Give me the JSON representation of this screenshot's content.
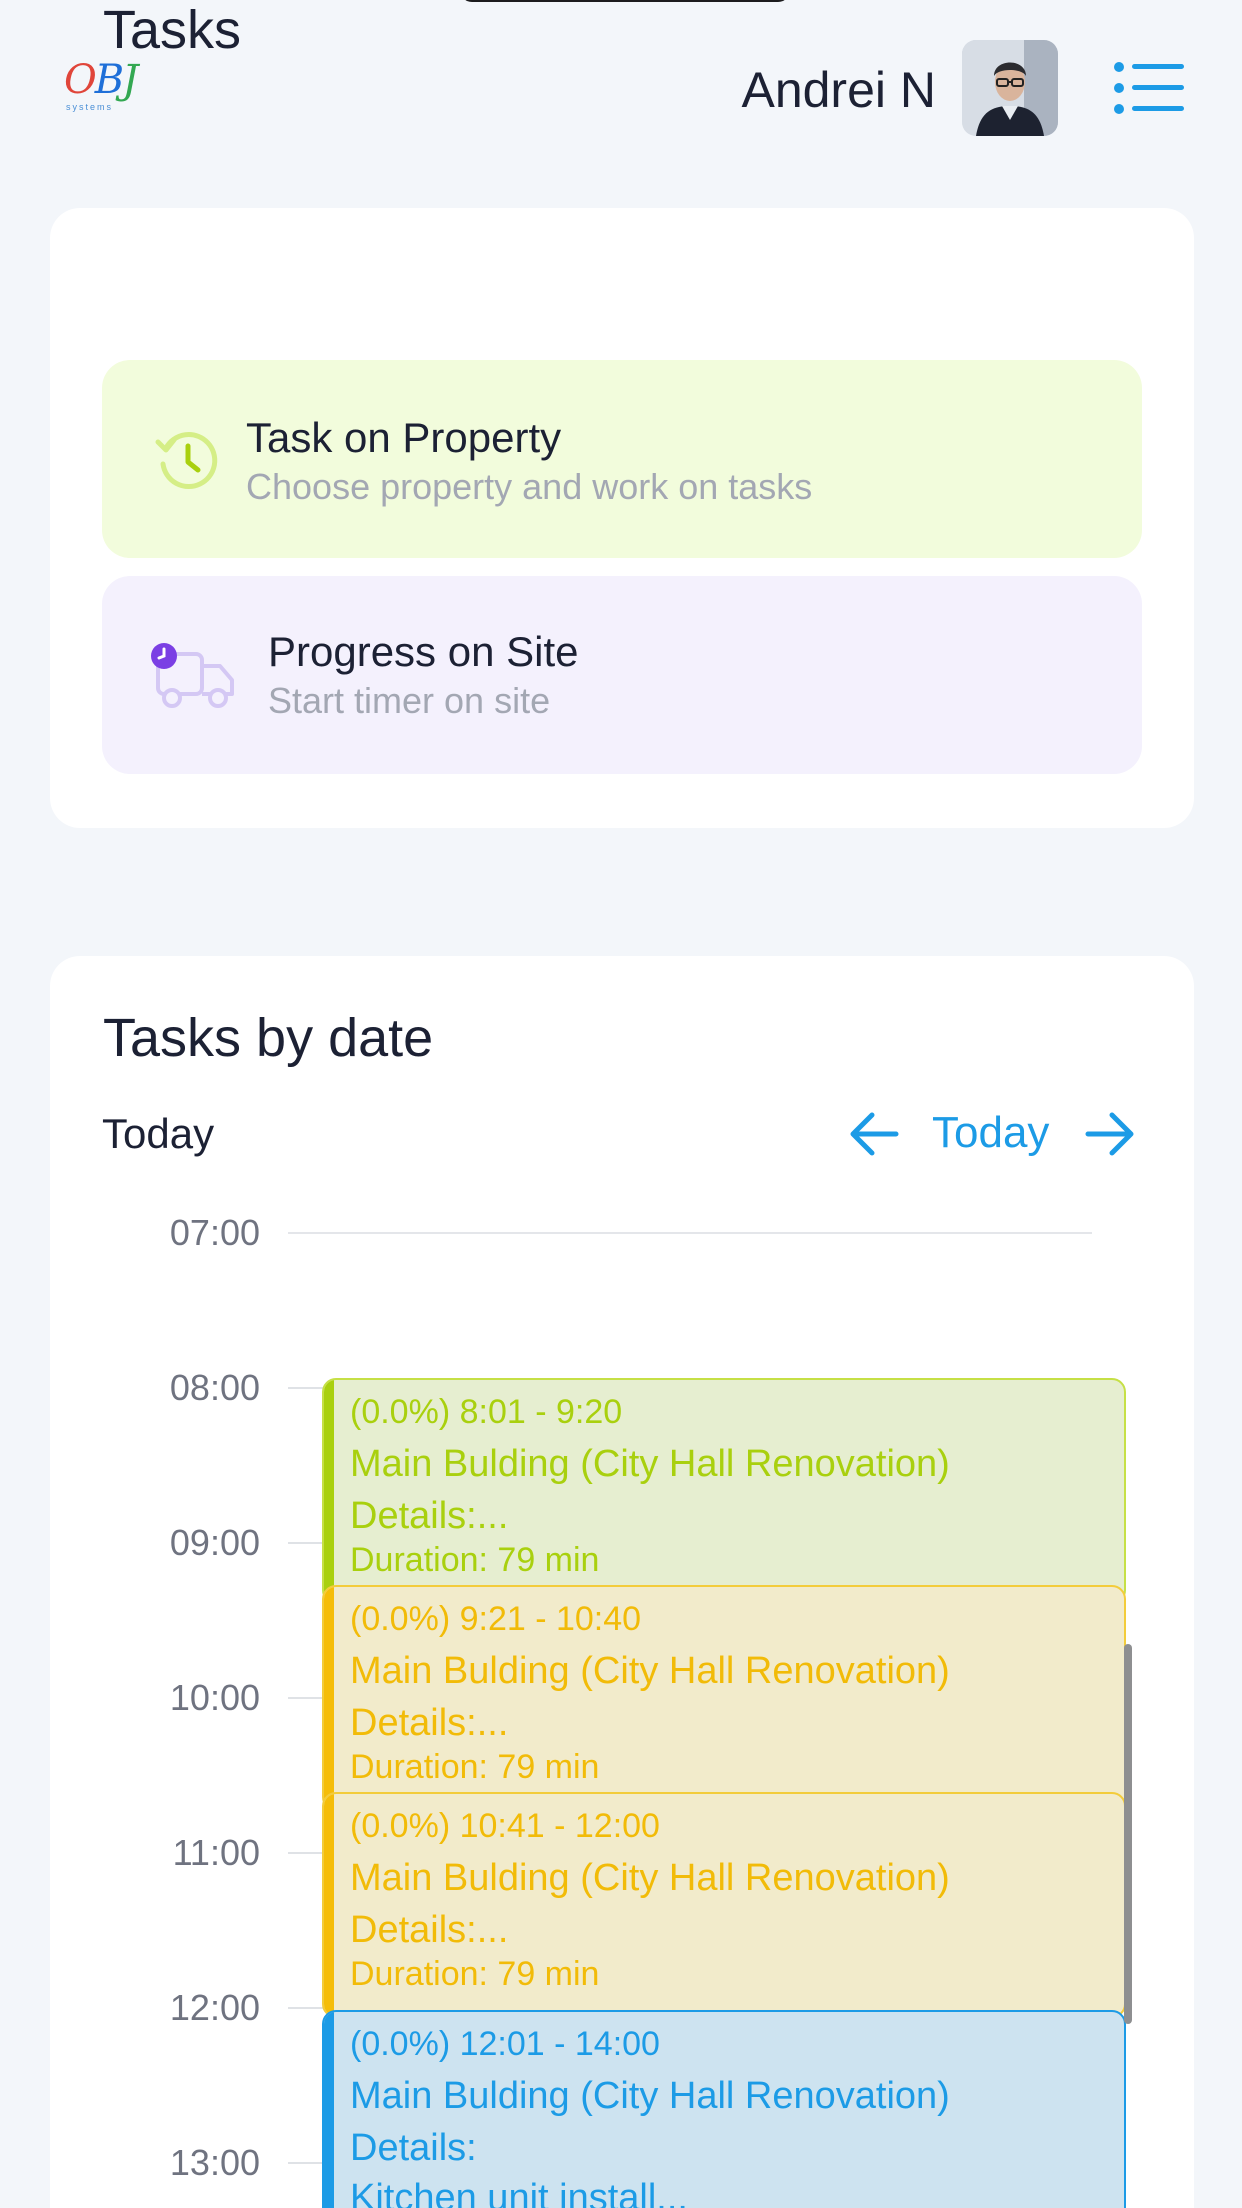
{
  "header": {
    "logo_text": "OBJ",
    "logo_subtext": "systems",
    "user_name": "Andrei N",
    "avatar_alt": "User avatar",
    "menu_icon": "list-icon"
  },
  "tasks_card": {
    "title": "Tasks",
    "actions": [
      {
        "title": "Task on Property",
        "subtitle": "Choose property and work on tasks",
        "icon": "clock-history-icon",
        "color": "#a9d00e"
      },
      {
        "title": "Progress on Site",
        "subtitle": "Start timer on site",
        "icon": "truck-timer-icon",
        "color": "#7b3fe4"
      }
    ]
  },
  "date_card": {
    "title": "Tasks by date",
    "current_label": "Today",
    "nav": {
      "prev_icon": "arrow-left-icon",
      "today_label": "Today",
      "next_icon": "arrow-right-icon"
    },
    "timeline": {
      "hours": [
        "07:00",
        "08:00",
        "09:00",
        "10:00",
        "11:00",
        "12:00",
        "13:00"
      ],
      "events": [
        {
          "time": "(0.0%) 8:01 - 9:20",
          "title": "Main Bulding (City Hall Renovation)",
          "details": "Details:...",
          "duration": "Duration: 79 min",
          "color": "#a9d00e"
        },
        {
          "time": "(0.0%) 9:21 - 10:40",
          "title": "Main Bulding (City Hall Renovation)",
          "details": "Details:...",
          "duration": "Duration: 79 min",
          "color": "#f5bd09"
        },
        {
          "time": "(0.0%) 10:41 - 12:00",
          "title": "Main Bulding (City Hall Renovation)",
          "details": "Details:...",
          "duration": "Duration: 79 min",
          "color": "#f5bd09"
        },
        {
          "time": "(0.0%) 12:01 - 14:00",
          "title": "Main Bulding (City Hall Renovation)",
          "details": "Details:",
          "duration": "Kitchen unit install...",
          "color": "#1c9be6"
        }
      ]
    }
  }
}
